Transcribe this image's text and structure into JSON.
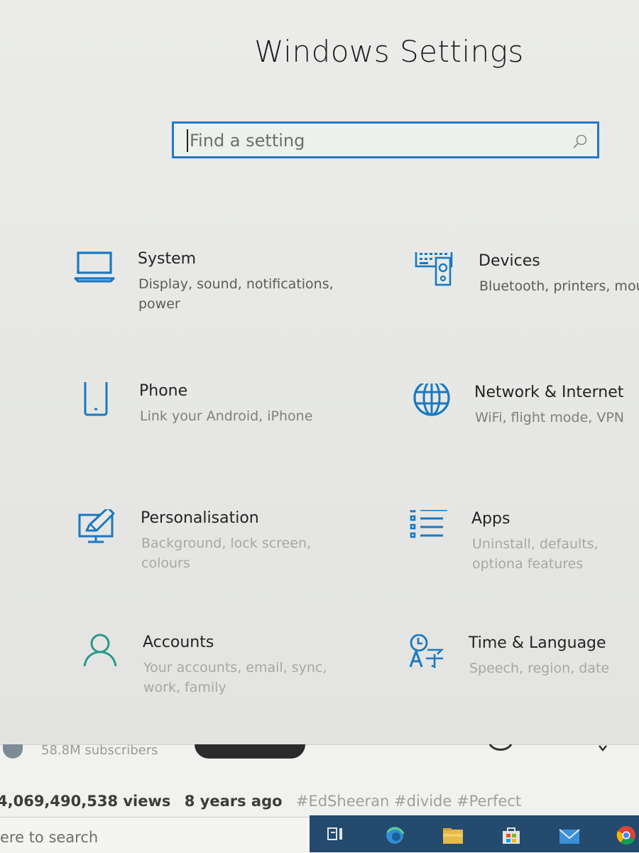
{
  "window": {
    "title": "Windows Settings"
  },
  "search": {
    "placeholder": "Find a setting"
  },
  "tiles": [
    {
      "title": "System",
      "desc": "Display, sound, notifications, power"
    },
    {
      "title": "Devices",
      "desc": "Bluetooth, printers, mou"
    },
    {
      "title": "Phone",
      "desc": "Link your Android, iPhone"
    },
    {
      "title": "Network & Internet",
      "desc": "WiFi, flight mode, VPN"
    },
    {
      "title": "Personalisation",
      "desc": "Background, lock screen, colours"
    },
    {
      "title": "Apps",
      "desc": "Uninstall, defaults, optiona features"
    },
    {
      "title": "Accounts",
      "desc": "Your accounts, email, sync, work, family"
    },
    {
      "title": "Time & Language",
      "desc": "Speech, region, date"
    }
  ],
  "icons": {
    "system": "laptop-icon",
    "devices": "keyboard-speaker-icon",
    "phone": "phone-icon",
    "network": "globe-icon",
    "personalisation": "paint-brush-icon",
    "apps": "apps-list-icon",
    "accounts": "person-icon",
    "time": "language-clock-icon",
    "search": "search-icon"
  },
  "colors": {
    "accent": "#1a78c2",
    "text": "#242424",
    "desc": "#5a5c5a",
    "taskbar": "#244a6e"
  },
  "background_video": {
    "subscribers": "58.8M subscribers",
    "views": "4,069,490,538 views",
    "age": "8 years ago",
    "tags": "#EdSheeran #divide #Perfect"
  },
  "taskbar": {
    "search_text": "ere to search"
  }
}
